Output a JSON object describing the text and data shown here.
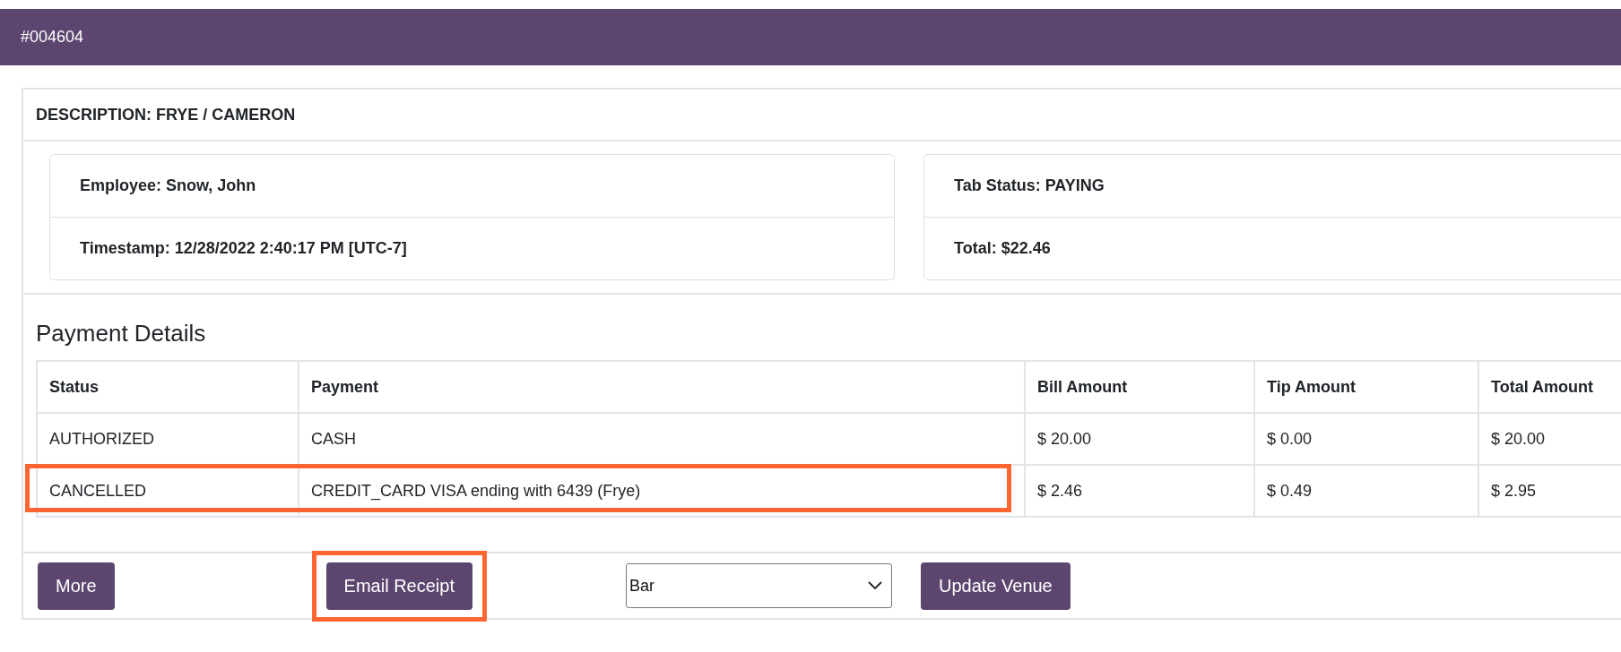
{
  "header": {
    "title": "#004604"
  },
  "description": "DESCRIPTION: FRYE / CAMERON",
  "info_cards": [
    {
      "items": [
        "Employee: Snow, John",
        "Timestamp: 12/28/2022 2:40:17 PM [UTC-7]"
      ]
    },
    {
      "items": [
        "Tab Status: PAYING",
        "Total: $22.46"
      ]
    }
  ],
  "payment_details": {
    "title": "Payment Details",
    "columns": [
      "Status",
      "Payment",
      "Bill Amount",
      "Tip Amount",
      "Total Amount"
    ],
    "rows": [
      {
        "status": "AUTHORIZED",
        "payment": "CASH",
        "bill": "$ 20.00",
        "tip": "$ 0.00",
        "total": "$ 20.00",
        "highlighted": false
      },
      {
        "status": "CANCELLED",
        "payment": "CREDIT_CARD VISA ending with 6439 (Frye)",
        "bill": "$ 2.46",
        "tip": "$ 0.49",
        "total": "$ 2.95",
        "highlighted": true
      }
    ]
  },
  "actions": [
    {
      "kind": "button",
      "label": "More",
      "highlighted": false
    },
    {
      "kind": "button",
      "label": "Email Receipt",
      "highlighted": true
    },
    {
      "kind": "select",
      "value": "Bar",
      "highlighted": false
    },
    {
      "kind": "button",
      "label": "Update Venue",
      "highlighted": false
    }
  ]
}
